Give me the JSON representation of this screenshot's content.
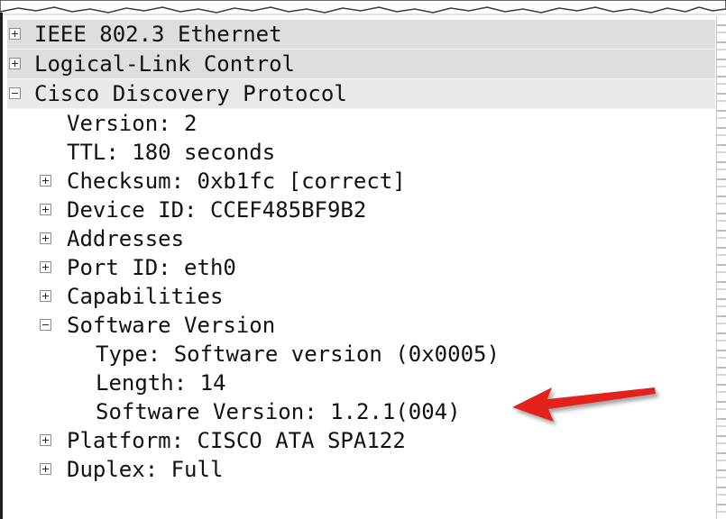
{
  "tree": {
    "rows": [
      {
        "label": "IEEE 802.3 Ethernet",
        "state": "collapsed"
      },
      {
        "label": "Logical-Link Control",
        "state": "collapsed"
      },
      {
        "label": "Cisco Discovery Protocol",
        "state": "expanded"
      },
      {
        "label": "Version: 2"
      },
      {
        "label": "TTL: 180 seconds"
      },
      {
        "label": "Checksum: 0xb1fc [correct]",
        "state": "collapsed"
      },
      {
        "label": "Device ID: CCEF485BF9B2",
        "state": "collapsed"
      },
      {
        "label": "Addresses",
        "state": "collapsed"
      },
      {
        "label": "Port ID: eth0",
        "state": "collapsed"
      },
      {
        "label": "Capabilities",
        "state": "collapsed"
      },
      {
        "label": "Software Version",
        "state": "expanded"
      },
      {
        "label": "Type: Software version (0x0005)"
      },
      {
        "label": "Length: 14"
      },
      {
        "label": "Software Version: 1.2.1(004)"
      },
      {
        "label": "Platform: CISCO ATA SPA122",
        "state": "collapsed"
      },
      {
        "label": "Duplex: Full",
        "state": "collapsed"
      }
    ]
  },
  "annotation": {
    "arrow_color": "#e3211b",
    "points_to": "Software Version: 1.2.1(004)"
  }
}
